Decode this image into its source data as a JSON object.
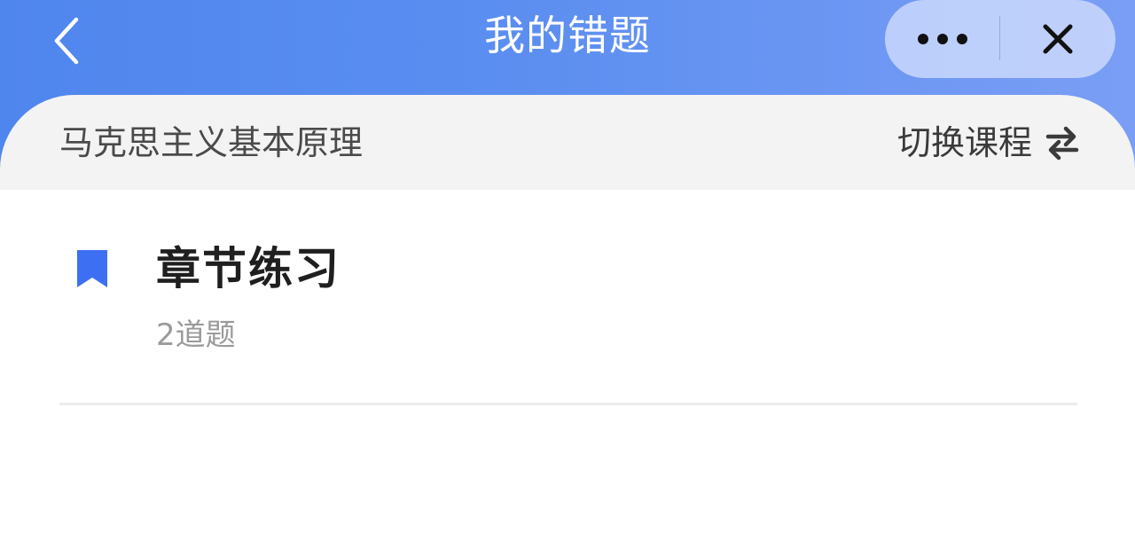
{
  "header": {
    "title": "我的错题",
    "back_icon": "chevron-left-icon",
    "more_icon": "more-dots-icon",
    "close_icon": "close-icon",
    "gradient_start": "#4f86ee",
    "gradient_end": "#7a9ef5"
  },
  "course": {
    "name": "马克思主义基本原理",
    "switch_label": "切换课程",
    "switch_icon": "swap-icon"
  },
  "items": [
    {
      "icon": "bookmark-icon",
      "icon_color": "#3d6ff2",
      "title": "章节练习",
      "count": "2道题"
    }
  ]
}
